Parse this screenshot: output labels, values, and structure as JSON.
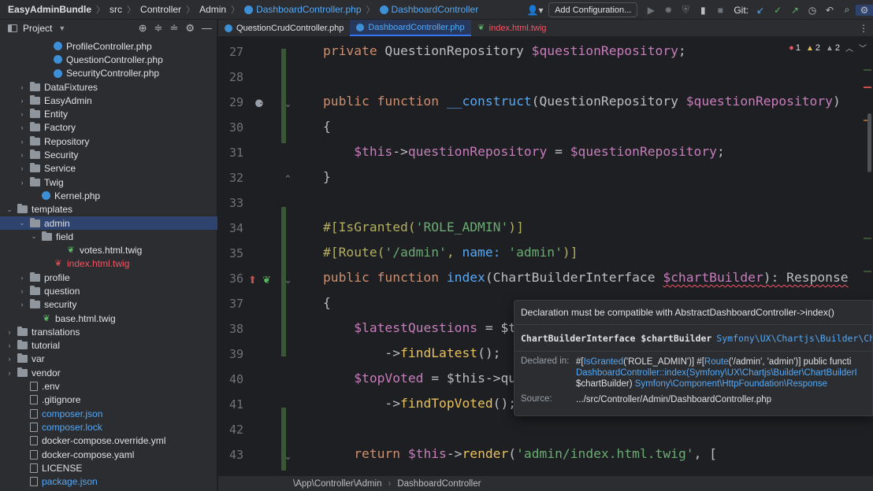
{
  "nav": {
    "crumbs": [
      "EasyAdminBundle",
      "src",
      "Controller",
      "Admin",
      "DashboardController.php",
      "DashboardController"
    ],
    "add_configuration": "Add Configuration...",
    "git_label": "Git:"
  },
  "project_panel": {
    "title": "Project",
    "items": [
      {
        "label": "ProfileController.php",
        "kind": "php"
      },
      {
        "label": "QuestionController.php",
        "kind": "php"
      },
      {
        "label": "SecurityController.php",
        "kind": "php"
      },
      {
        "label": "DataFixtures",
        "kind": "folder",
        "state": "collapsed"
      },
      {
        "label": "EasyAdmin",
        "kind": "folder",
        "state": "collapsed"
      },
      {
        "label": "Entity",
        "kind": "folder",
        "state": "collapsed"
      },
      {
        "label": "Factory",
        "kind": "folder",
        "state": "collapsed"
      },
      {
        "label": "Repository",
        "kind": "folder",
        "state": "collapsed"
      },
      {
        "label": "Security",
        "kind": "folder",
        "state": "collapsed"
      },
      {
        "label": "Service",
        "kind": "folder",
        "state": "collapsed"
      },
      {
        "label": "Twig",
        "kind": "folder",
        "state": "collapsed"
      },
      {
        "label": "Kernel.php",
        "kind": "php"
      },
      {
        "label": "templates",
        "kind": "folder",
        "state": "expanded"
      },
      {
        "label": "admin",
        "kind": "folder",
        "state": "expanded"
      },
      {
        "label": "field",
        "kind": "folder",
        "state": "expanded"
      },
      {
        "label": "votes.html.twig",
        "kind": "twig"
      },
      {
        "label": "index.html.twig",
        "kind": "twig"
      },
      {
        "label": "profile",
        "kind": "folder",
        "state": "collapsed"
      },
      {
        "label": "question",
        "kind": "folder",
        "state": "collapsed"
      },
      {
        "label": "security",
        "kind": "folder",
        "state": "collapsed"
      },
      {
        "label": "base.html.twig",
        "kind": "twig"
      },
      {
        "label": "translations",
        "kind": "folder",
        "state": "collapsed"
      },
      {
        "label": "tutorial",
        "kind": "folder",
        "state": "collapsed"
      },
      {
        "label": "var",
        "kind": "folder",
        "state": "collapsed"
      },
      {
        "label": "vendor",
        "kind": "folder",
        "state": "collapsed"
      },
      {
        "label": ".env",
        "kind": "file"
      },
      {
        "label": ".gitignore",
        "kind": "file"
      },
      {
        "label": "composer.json",
        "kind": "file"
      },
      {
        "label": "composer.lock",
        "kind": "file"
      },
      {
        "label": "docker-compose.override.yml",
        "kind": "file"
      },
      {
        "label": "docker-compose.yaml",
        "kind": "file"
      },
      {
        "label": "LICENSE",
        "kind": "file"
      },
      {
        "label": "package.json",
        "kind": "file"
      }
    ]
  },
  "tabs": [
    {
      "label": "QuestionCrudController.php",
      "kind": "php"
    },
    {
      "label": "DashboardController.php",
      "kind": "php",
      "active": true
    },
    {
      "label": "index.html.twig",
      "kind": "twig"
    }
  ],
  "inspections": {
    "errors": "1",
    "warnings": "2",
    "weak_warnings": "2"
  },
  "editor": {
    "line_numbers": [
      "27",
      "28",
      "29",
      "30",
      "31",
      "32",
      "33",
      "34",
      "35",
      "36",
      "37",
      "38",
      "39",
      "40",
      "41",
      "42",
      "43"
    ],
    "lines": [
      [
        [
          "kw",
          "private "
        ],
        [
          "plain",
          "QuestionRepository "
        ],
        [
          "var",
          "$questionRepository"
        ],
        [
          "plain",
          ";"
        ]
      ],
      [],
      [
        [
          "kw",
          "public function "
        ],
        [
          "fn",
          "__construct"
        ],
        [
          "plain",
          "(QuestionRepository "
        ],
        [
          "var",
          "$questionRepository"
        ],
        [
          "plain",
          ")"
        ]
      ],
      [
        [
          "plain",
          "{"
        ]
      ],
      [
        [
          "plain",
          "    "
        ],
        [
          "var",
          "$this"
        ],
        [
          "plain",
          "->"
        ],
        [
          "var",
          "questionRepository"
        ],
        [
          "plain",
          " = "
        ],
        [
          "var",
          "$questionRepository"
        ],
        [
          "plain",
          ";"
        ]
      ],
      [
        [
          "plain",
          "}"
        ]
      ],
      [],
      [
        [
          "attr",
          "#[IsGranted("
        ],
        [
          "str",
          "'ROLE_ADMIN'"
        ],
        [
          "attr",
          ")]"
        ]
      ],
      [
        [
          "attr",
          "#[Route("
        ],
        [
          "str",
          "'/admin'"
        ],
        [
          "attr",
          ", "
        ],
        [
          "named",
          "name: "
        ],
        [
          "str",
          "'admin'"
        ],
        [
          "attr",
          ")]"
        ]
      ],
      [
        [
          "kw",
          "public function "
        ],
        [
          "fn",
          "index"
        ],
        [
          "plain",
          "("
        ],
        [
          "plain",
          "ChartBuilderInterface "
        ],
        [
          "var",
          "$chartBuilder"
        ],
        [
          "plain",
          "): Response"
        ]
      ],
      [
        [
          "plain",
          "{"
        ]
      ],
      [
        [
          "plain",
          "    "
        ],
        [
          "var",
          "$latestQuestions"
        ],
        [
          "plain",
          " = $t"
        ]
      ],
      [
        [
          "plain",
          "        ->"
        ],
        [
          "call",
          "findLatest"
        ],
        [
          "plain",
          "();"
        ]
      ],
      [
        [
          "plain",
          "    "
        ],
        [
          "var",
          "$topVoted"
        ],
        [
          "plain",
          " = $this->qu"
        ]
      ],
      [
        [
          "plain",
          "        ->"
        ],
        [
          "call",
          "findTopVoted"
        ],
        [
          "plain",
          "();"
        ]
      ],
      [],
      [
        [
          "plain",
          "    "
        ],
        [
          "kw",
          "return "
        ],
        [
          "var",
          "$this"
        ],
        [
          "plain",
          "->"
        ],
        [
          "call",
          "render"
        ],
        [
          "plain",
          "("
        ],
        [
          "str",
          "'admin/index.html.twig'"
        ],
        [
          "plain",
          ", ["
        ]
      ]
    ]
  },
  "popup": {
    "message": "Declaration must be compatible with AbstractDashboardController->index()",
    "signature_bold": "ChartBuilderInterface $chartBuilder",
    "signature_link": "Symfony\\UX\\Chartjs\\Builder\\Cha",
    "declared_label": "Declared in:",
    "declared_l1_a": "#[",
    "declared_l1_b": "IsGranted",
    "declared_l1_c": "('ROLE_ADMIN')] #[",
    "declared_l1_d": "Route",
    "declared_l1_e": "('/admin', 'admin')] public functi",
    "declared_l2_a": "DashboardController::index",
    "declared_l2_b": "(Symfony\\UX\\Chartjs\\Builder\\ChartBuilderI",
    "declared_l3_a": "$chartBuilder) ",
    "declared_l3_b": "Symfony\\Component\\HttpFoundation\\Response",
    "source_label": "Source:",
    "source_value": ".../src/Controller/Admin/DashboardController.php"
  },
  "statusbar": {
    "path": [
      "\\App\\Controller\\Admin",
      "DashboardController"
    ]
  }
}
